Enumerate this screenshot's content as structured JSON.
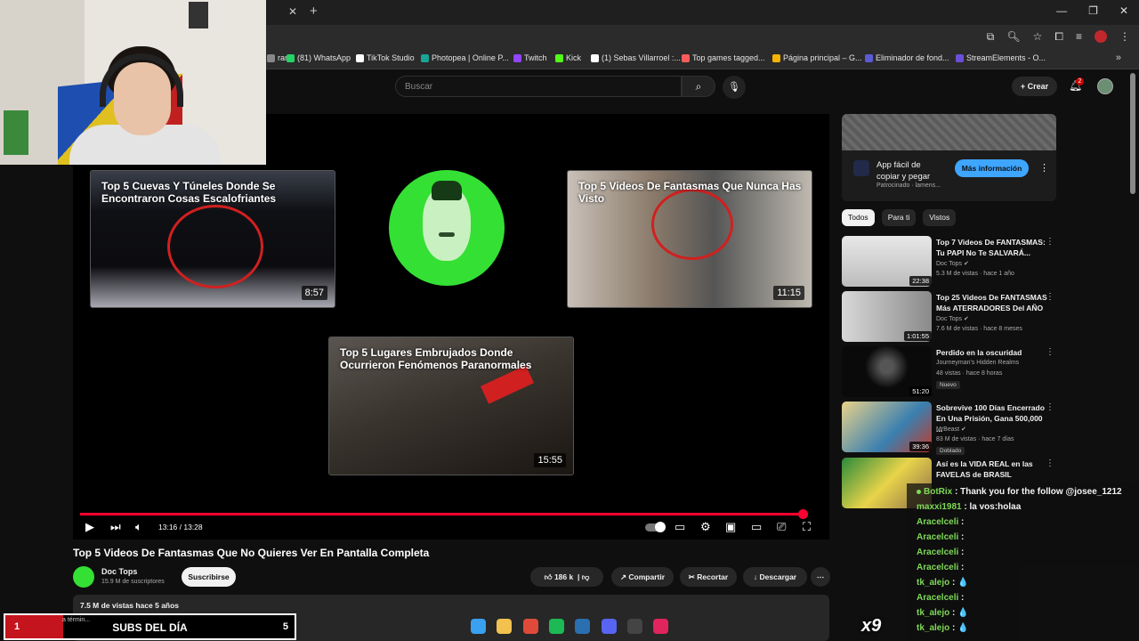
{
  "browser": {
    "bookmarks": [
      {
        "label": "ram",
        "color": "#888888"
      },
      {
        "label": "(81) WhatsApp",
        "color": "#25d366"
      },
      {
        "label": "TikTok Studio",
        "color": "#ffffff"
      },
      {
        "label": "Photopea | Online P...",
        "color": "#18a497"
      },
      {
        "label": "Twitch",
        "color": "#9146ff"
      },
      {
        "label": "Kick",
        "color": "#53fc18"
      },
      {
        "label": "(1) Sebas Villarroel :...",
        "color": "#ffffff"
      },
      {
        "label": "Top games tagged...",
        "color": "#fa5c5c"
      },
      {
        "label": "Página principal – G...",
        "color": "#f4b400"
      },
      {
        "label": "Eliminador de fond...",
        "color": "#5b5bd6"
      },
      {
        "label": "StreamElements - O...",
        "color": "#6b4fd8"
      }
    ]
  },
  "header": {
    "search_placeholder": "Buscar",
    "create_label": "+ Crear",
    "notifications": "2"
  },
  "player": {
    "endcards": [
      {
        "title": "Top 5 Cuevas Y Túneles Donde Se Encontraron Cosas Escalofriantes",
        "duration": "8:57"
      },
      {
        "title": "Top 5 Videos De Fantasmas Que Nunca Has Visto",
        "duration": "11:15"
      },
      {
        "title": "Top 5 Lugares Embrujados Donde Ocurrieron Fenómenos Paranormales",
        "duration": "15:55"
      }
    ],
    "time": "13:16 / 13:28",
    "progress": 0.985
  },
  "video": {
    "title": "Top 5 Videos De Fantasmas Que No Quieres Ver En Pantalla Completa",
    "channel": "Doc Tops",
    "subscribers": "15.9 M de suscriptores",
    "subscribe_label": "Suscribirse",
    "likes": "186 k",
    "share_label": "Compartir",
    "clip_label": "Recortar",
    "download_label": "Descargar",
    "meta": "7.5 M de vistas  hace 5 años"
  },
  "sidebar": {
    "ad": {
      "title": "App fácil de copiar y pegar",
      "sponsor": "Patrocinado · lamens...",
      "button": "Más información"
    },
    "chips": [
      "Todos",
      "Para ti",
      "Vistos"
    ],
    "recommendations": [
      {
        "title": "Top 7 Videos De FANTASMAS: Tu PAPI No Te SALVARÁ...",
        "channel": "Doc Tops ✔",
        "meta": "5.3 M de vistas · hace 1 año",
        "duration": "22:38",
        "badge": ""
      },
      {
        "title": "Top 25 Videos De FANTASMAS Más ATERRADORES Del AÑO",
        "channel": "Doc Tops ✔",
        "meta": "7.6 M de vistas · hace 8 meses",
        "duration": "1:01:55",
        "badge": ""
      },
      {
        "title": "Perdido en la oscuridad",
        "channel": "Journeyman's Hidden Realms",
        "meta": "48 vistas · hace 8 horas",
        "duration": "51:20",
        "badge": "Nuevo"
      },
      {
        "title": "Sobrevive 100 Días Encerrado En Una Prisión, Gana 500,000 ...",
        "channel": "MrBeast ✔",
        "meta": "83 M de vistas · hace 7 días",
        "duration": "39:36",
        "badge": "Doblado"
      },
      {
        "title": "Así es la VIDA REAL en las FAVELAS de BRASIL",
        "channel": "",
        "meta": "",
        "duration": "",
        "badge": ""
      }
    ]
  },
  "chat": [
    {
      "user": "BotRix",
      "text": "Thank you for the follow @josee_1212"
    },
    {
      "user": "maxxi1981",
      "text": "la vos:holaa"
    },
    {
      "user": "Aracelceli",
      "text": ""
    },
    {
      "user": "Aracelceli",
      "text": ""
    },
    {
      "user": "Aracelceli",
      "text": ""
    },
    {
      "user": "Aracelceli",
      "text": ""
    },
    {
      "user": "tk_alejo",
      "text": "💧"
    },
    {
      "user": "Aracelceli",
      "text": ""
    },
    {
      "user": "tk_alejo",
      "text": "💧"
    },
    {
      "user": "tk_alejo",
      "text": "💧"
    }
  ],
  "overlay": {
    "x_count": "x9",
    "subgoal_current": "1",
    "subgoal_label": "SUBS DEL DÍA",
    "subgoal_goal": "5",
    "subgoal_tag": "a términ..."
  },
  "taskbar": {
    "icons": [
      {
        "name": "windows-start-icon",
        "color": "#3aa0f0"
      },
      {
        "name": "file-explorer-icon",
        "color": "#f2c14e"
      },
      {
        "name": "chrome-icon",
        "color": "#e04a3a"
      },
      {
        "name": "spotify-icon",
        "color": "#1db954"
      },
      {
        "name": "steam-icon",
        "color": "#2a6fb0"
      },
      {
        "name": "discord-icon",
        "color": "#5865f2"
      },
      {
        "name": "obs-icon",
        "color": "#444444"
      },
      {
        "name": "tiktok-icon",
        "color": "#e0245e"
      }
    ]
  }
}
